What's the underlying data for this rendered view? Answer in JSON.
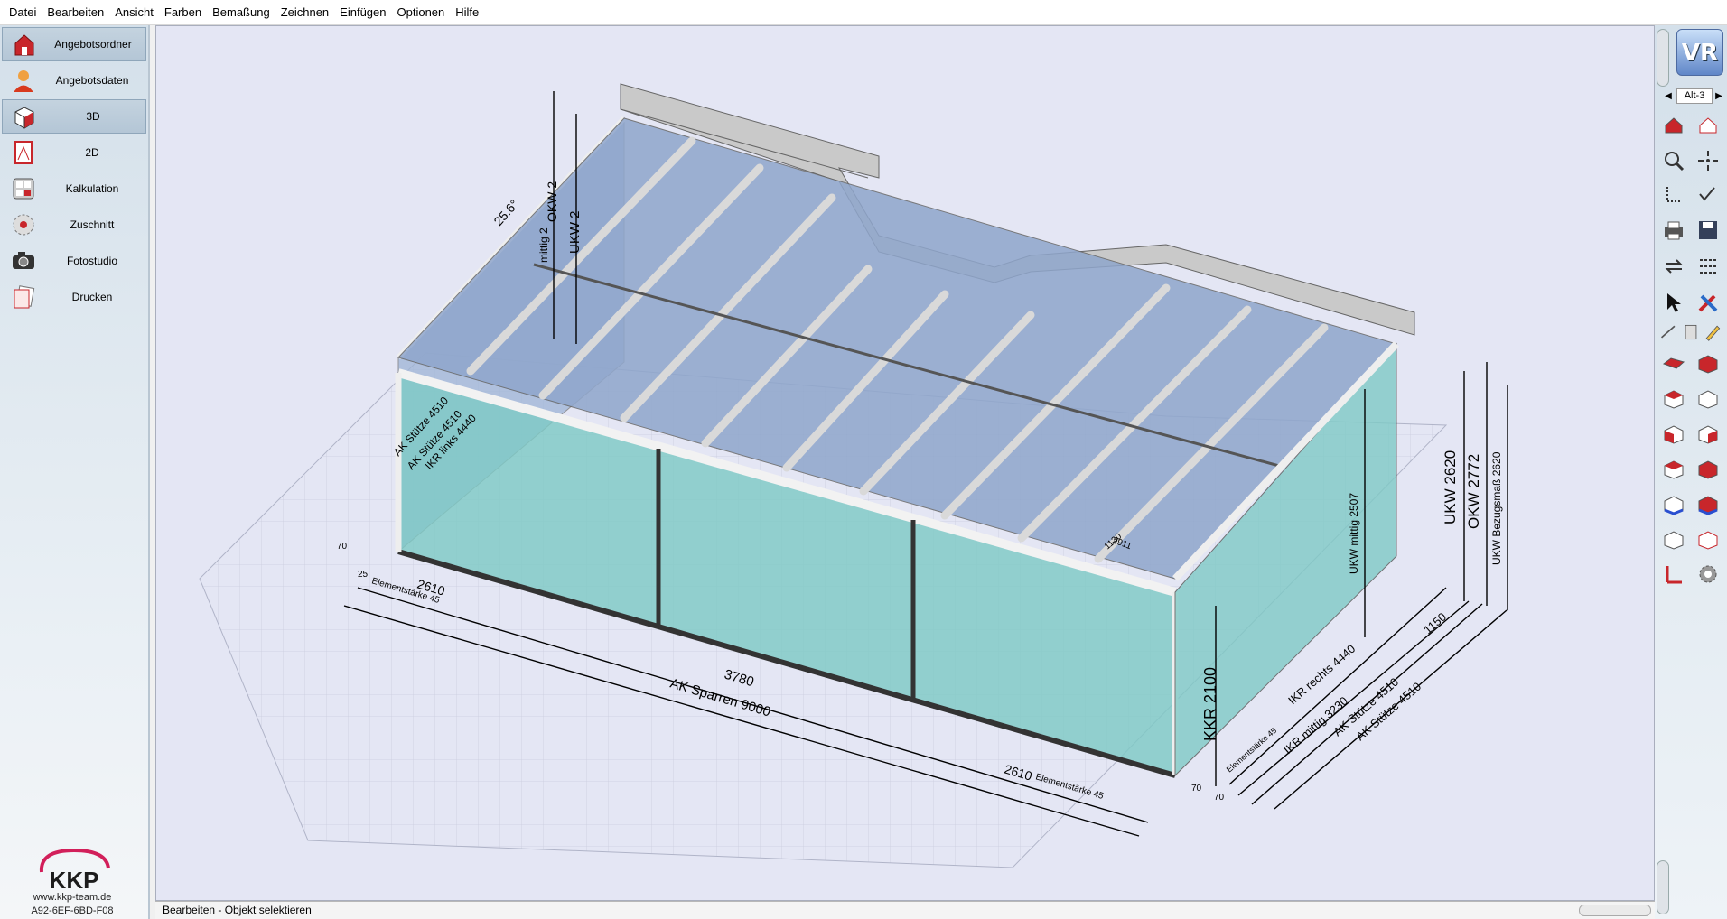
{
  "menu": [
    "Datei",
    "Bearbeiten",
    "Ansicht",
    "Farben",
    "Bemaßung",
    "Zeichnen",
    "Einfügen",
    "Optionen",
    "Hilfe"
  ],
  "sidebar": {
    "items": [
      {
        "label": "Angebotsordner",
        "icon": "folder-house-icon",
        "active": true
      },
      {
        "label": "Angebotsdaten",
        "icon": "person-icon",
        "active": false
      },
      {
        "label": "3D",
        "icon": "cube-icon",
        "active": true
      },
      {
        "label": "2D",
        "icon": "drawing-icon",
        "active": false
      },
      {
        "label": "Kalkulation",
        "icon": "calculator-icon",
        "active": false
      },
      {
        "label": "Zuschnitt",
        "icon": "saw-blade-icon",
        "active": false
      },
      {
        "label": "Fotostudio",
        "icon": "camera-icon",
        "active": false
      },
      {
        "label": "Drucken",
        "icon": "print-pages-icon",
        "active": false
      }
    ],
    "logo_text": "KKP",
    "website": "www.kkp-team.de",
    "code": "A92-6EF-6BD-F08"
  },
  "rightbar": {
    "logo_text": "VR",
    "view_label": "Alt-3"
  },
  "status": {
    "text": "Bearbeiten - Objekt selektieren"
  },
  "dimensions": {
    "ukw": "UKW  2620",
    "okw": "OKW  2772",
    "ukw_ref": "UKW Bezugsmaß  2620",
    "ukw_mittig": "UKW mittig  2507",
    "kkr": "KKR  2100",
    "ak_sparren": "AK Sparren  9000",
    "span_mid": "3780",
    "span_left": "2610",
    "span_right": "2610",
    "element_left": "Elementstärke  45",
    "element_right": "Elementstärke  45",
    "element_side": "Elementstärke  45",
    "ikr_rechts": "IKR rechts  4440",
    "ikr_mittig": "IKR mittig  3230",
    "ak_stuetze_a": "AK Stütze  4510",
    "ak_stuetze_b": "AK Stütze  4510",
    "side_1150": "1150",
    "left_stuetze": "AK Stütze  4510",
    "left_ikr": "IKR links  4440",
    "left_stuetze2": "AK Stütze  4510",
    "angle": "25.6°",
    "okw_left": "OKW  2",
    "ukw_mittig_left": "mittig  2",
    "ukw_left": "UKW  2",
    "small_70": "70",
    "small_70b": "70",
    "small_70c": "70",
    "small_25": "25",
    "small_1130": "1130",
    "small_2911": "2911"
  }
}
